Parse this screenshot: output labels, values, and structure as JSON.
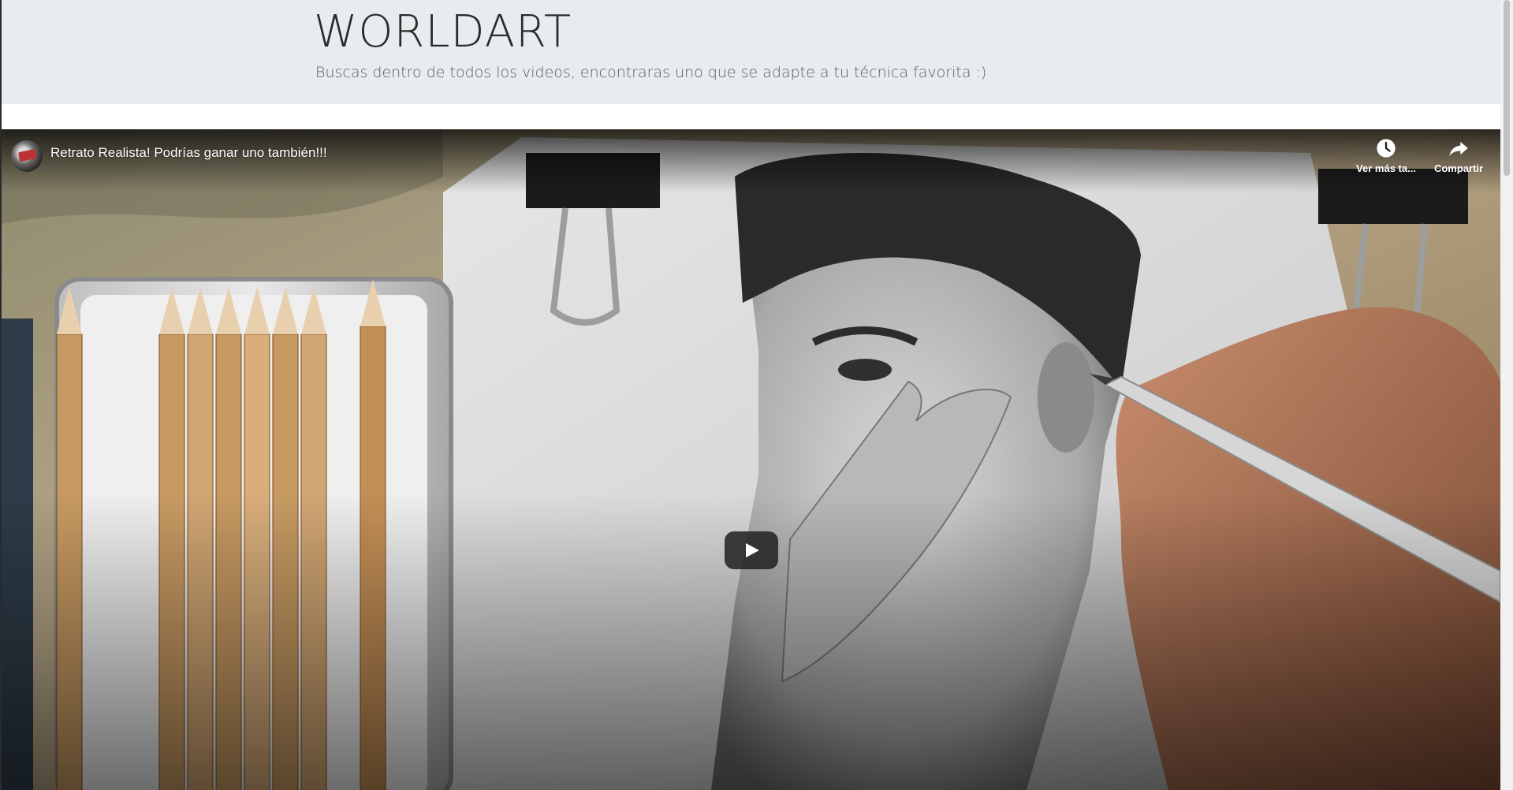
{
  "header": {
    "title": "WORLDART",
    "lead": "Buscas dentro de todos los videos, encontraras uno que se adapte a tu técnica favorita :)"
  },
  "video": {
    "title": "Retrato Realista! Podrías ganar uno también!!!",
    "actions": {
      "watch_later_label": "Ver más ta...",
      "watch_later_icon": "clock-icon",
      "share_label": "Compartir",
      "share_icon": "share-arrow-icon"
    },
    "play_icon": "play-icon"
  }
}
